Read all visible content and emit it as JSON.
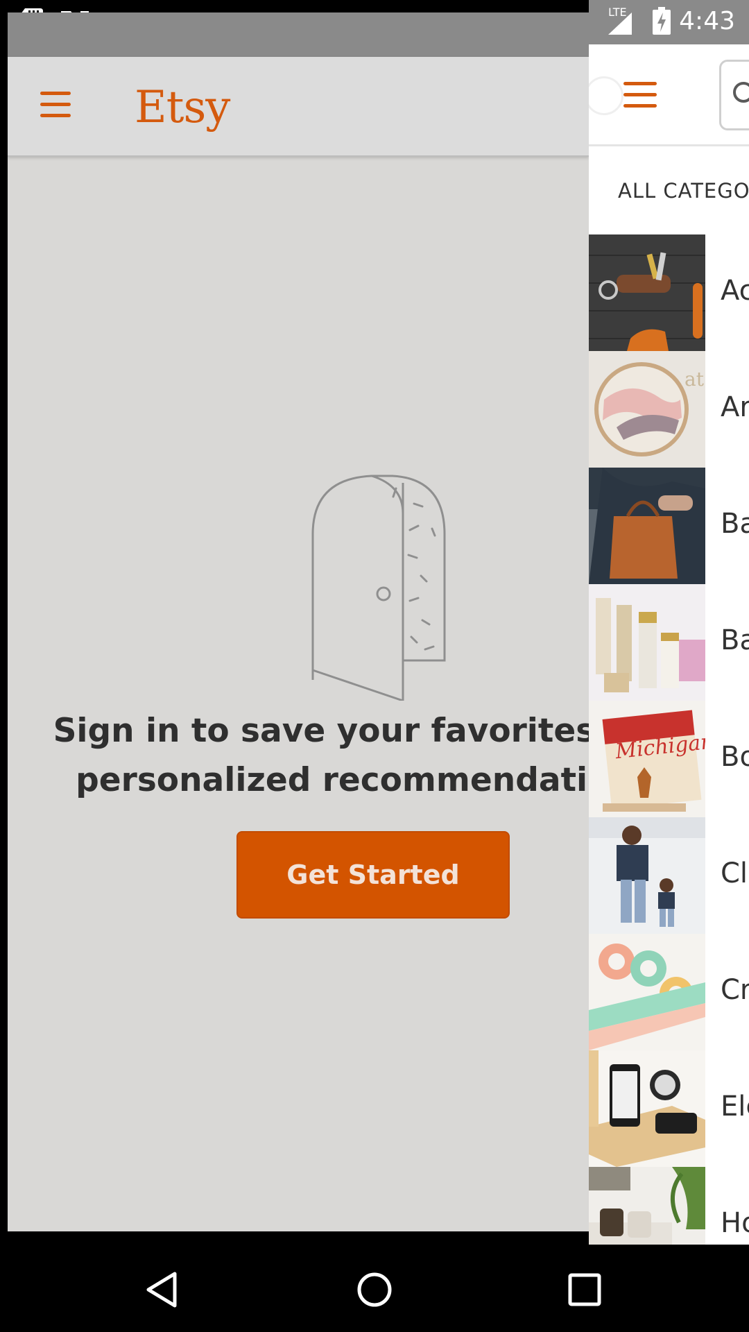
{
  "status_bar": {
    "time": "4:43",
    "network": "LTE"
  },
  "app": {
    "logo": "Etsy",
    "empty_state": {
      "message": "Sign in to save your favorites and\npersonalized recommendations",
      "button_label": "Get Started"
    }
  },
  "drawer": {
    "categories_header": "ALL CATEGORIES",
    "categories": [
      {
        "label": "Accessories",
        "icon": "keychains-photo"
      },
      {
        "label": "Art & Collectibles",
        "icon": "embroidery-hoop-photo"
      },
      {
        "label": "Bags & Purses",
        "icon": "leather-tote-photo"
      },
      {
        "label": "Bath & Beauty",
        "icon": "cosmetics-bottles-photo"
      },
      {
        "label": "Books, Movies & Music",
        "icon": "michigan-book-photo"
      },
      {
        "label": "Clothing",
        "icon": "father-son-photo"
      },
      {
        "label": "Craft Supplies & Tools",
        "icon": "washi-tape-photo"
      },
      {
        "label": "Electronics & Accessories",
        "icon": "phone-dock-photo"
      },
      {
        "label": "Home & Living",
        "icon": "living-room-photo"
      }
    ]
  },
  "colors": {
    "brand_orange": "#d35400",
    "drawer_bg": "#ffffff",
    "scrim_bg": "#d9d8d6"
  }
}
